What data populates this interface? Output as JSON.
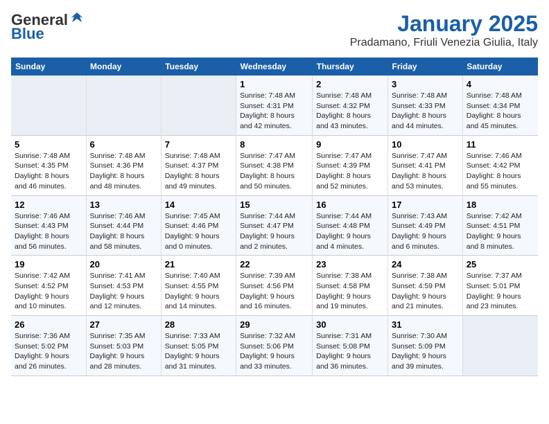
{
  "header": {
    "logo_general": "General",
    "logo_blue": "Blue",
    "title": "January 2025",
    "subtitle": "Pradamano, Friuli Venezia Giulia, Italy"
  },
  "days_of_week": [
    "Sunday",
    "Monday",
    "Tuesday",
    "Wednesday",
    "Thursday",
    "Friday",
    "Saturday"
  ],
  "weeks": [
    [
      {
        "day": null
      },
      {
        "day": null
      },
      {
        "day": null
      },
      {
        "day": "1",
        "sunrise": "7:48 AM",
        "sunset": "4:31 PM",
        "daylight": "8 hours and 42 minutes."
      },
      {
        "day": "2",
        "sunrise": "7:48 AM",
        "sunset": "4:32 PM",
        "daylight": "8 hours and 43 minutes."
      },
      {
        "day": "3",
        "sunrise": "7:48 AM",
        "sunset": "4:33 PM",
        "daylight": "8 hours and 44 minutes."
      },
      {
        "day": "4",
        "sunrise": "7:48 AM",
        "sunset": "4:34 PM",
        "daylight": "8 hours and 45 minutes."
      }
    ],
    [
      {
        "day": "5",
        "sunrise": "7:48 AM",
        "sunset": "4:35 PM",
        "daylight": "8 hours and 46 minutes."
      },
      {
        "day": "6",
        "sunrise": "7:48 AM",
        "sunset": "4:36 PM",
        "daylight": "8 hours and 48 minutes."
      },
      {
        "day": "7",
        "sunrise": "7:48 AM",
        "sunset": "4:37 PM",
        "daylight": "8 hours and 49 minutes."
      },
      {
        "day": "8",
        "sunrise": "7:47 AM",
        "sunset": "4:38 PM",
        "daylight": "8 hours and 50 minutes."
      },
      {
        "day": "9",
        "sunrise": "7:47 AM",
        "sunset": "4:39 PM",
        "daylight": "8 hours and 52 minutes."
      },
      {
        "day": "10",
        "sunrise": "7:47 AM",
        "sunset": "4:41 PM",
        "daylight": "8 hours and 53 minutes."
      },
      {
        "day": "11",
        "sunrise": "7:46 AM",
        "sunset": "4:42 PM",
        "daylight": "8 hours and 55 minutes."
      }
    ],
    [
      {
        "day": "12",
        "sunrise": "7:46 AM",
        "sunset": "4:43 PM",
        "daylight": "8 hours and 56 minutes."
      },
      {
        "day": "13",
        "sunrise": "7:46 AM",
        "sunset": "4:44 PM",
        "daylight": "8 hours and 58 minutes."
      },
      {
        "day": "14",
        "sunrise": "7:45 AM",
        "sunset": "4:46 PM",
        "daylight": "9 hours and 0 minutes."
      },
      {
        "day": "15",
        "sunrise": "7:44 AM",
        "sunset": "4:47 PM",
        "daylight": "9 hours and 2 minutes."
      },
      {
        "day": "16",
        "sunrise": "7:44 AM",
        "sunset": "4:48 PM",
        "daylight": "9 hours and 4 minutes."
      },
      {
        "day": "17",
        "sunrise": "7:43 AM",
        "sunset": "4:49 PM",
        "daylight": "9 hours and 6 minutes."
      },
      {
        "day": "18",
        "sunrise": "7:42 AM",
        "sunset": "4:51 PM",
        "daylight": "9 hours and 8 minutes."
      }
    ],
    [
      {
        "day": "19",
        "sunrise": "7:42 AM",
        "sunset": "4:52 PM",
        "daylight": "9 hours and 10 minutes."
      },
      {
        "day": "20",
        "sunrise": "7:41 AM",
        "sunset": "4:53 PM",
        "daylight": "9 hours and 12 minutes."
      },
      {
        "day": "21",
        "sunrise": "7:40 AM",
        "sunset": "4:55 PM",
        "daylight": "9 hours and 14 minutes."
      },
      {
        "day": "22",
        "sunrise": "7:39 AM",
        "sunset": "4:56 PM",
        "daylight": "9 hours and 16 minutes."
      },
      {
        "day": "23",
        "sunrise": "7:38 AM",
        "sunset": "4:58 PM",
        "daylight": "9 hours and 19 minutes."
      },
      {
        "day": "24",
        "sunrise": "7:38 AM",
        "sunset": "4:59 PM",
        "daylight": "9 hours and 21 minutes."
      },
      {
        "day": "25",
        "sunrise": "7:37 AM",
        "sunset": "5:01 PM",
        "daylight": "9 hours and 23 minutes."
      }
    ],
    [
      {
        "day": "26",
        "sunrise": "7:36 AM",
        "sunset": "5:02 PM",
        "daylight": "9 hours and 26 minutes."
      },
      {
        "day": "27",
        "sunrise": "7:35 AM",
        "sunset": "5:03 PM",
        "daylight": "9 hours and 28 minutes."
      },
      {
        "day": "28",
        "sunrise": "7:33 AM",
        "sunset": "5:05 PM",
        "daylight": "9 hours and 31 minutes."
      },
      {
        "day": "29",
        "sunrise": "7:32 AM",
        "sunset": "5:06 PM",
        "daylight": "9 hours and 33 minutes."
      },
      {
        "day": "30",
        "sunrise": "7:31 AM",
        "sunset": "5:08 PM",
        "daylight": "9 hours and 36 minutes."
      },
      {
        "day": "31",
        "sunrise": "7:30 AM",
        "sunset": "5:09 PM",
        "daylight": "9 hours and 39 minutes."
      },
      {
        "day": null
      }
    ]
  ],
  "labels": {
    "sunrise": "Sunrise:",
    "sunset": "Sunset:",
    "daylight": "Daylight:"
  }
}
